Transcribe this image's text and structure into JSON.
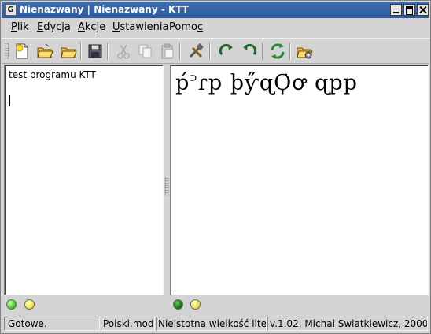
{
  "window": {
    "title": "Nienazwany | Nienazwany - KTT",
    "app_icon_glyph": "G"
  },
  "menubar": {
    "items": [
      {
        "label_pre": "",
        "label_acc": "P",
        "label_post": "lik"
      },
      {
        "label_pre": "",
        "label_acc": "E",
        "label_post": "dycja"
      },
      {
        "label_pre": "",
        "label_acc": "A",
        "label_post": "kcje"
      },
      {
        "label_pre": "",
        "label_acc": "U",
        "label_post": "stawienia"
      },
      {
        "label_pre": "Pomo",
        "label_acc": "c",
        "label_post": ""
      }
    ]
  },
  "toolbar": {
    "icons": [
      "new-file-icon",
      "open-file-icon",
      "open-file-alt-icon",
      "save-icon",
      "cut-icon",
      "copy-icon",
      "paste-icon",
      "tools-icon",
      "redo-icon",
      "undo-icon",
      "refresh-icon",
      "open-settings-icon"
    ]
  },
  "editor": {
    "source_text": "test programu KTT",
    "tengwar_text": "ṕ꜄ɾp þƴ̋ɋϘ̇ꝍ ɋpp"
  },
  "indicators": {
    "left": [
      "green",
      "yellow"
    ],
    "right": [
      "dark-green",
      "yellow"
    ]
  },
  "statusbar": {
    "status": "Gotowe.",
    "mode_file": "Polski.mod",
    "case_mode": "Nieistotna wielkość liter",
    "version": "v.1.02, Michal Swiatkiewicz, 2000"
  },
  "colors": {
    "titlebar": "#2e5a9c",
    "background": "#d4d4d4"
  }
}
